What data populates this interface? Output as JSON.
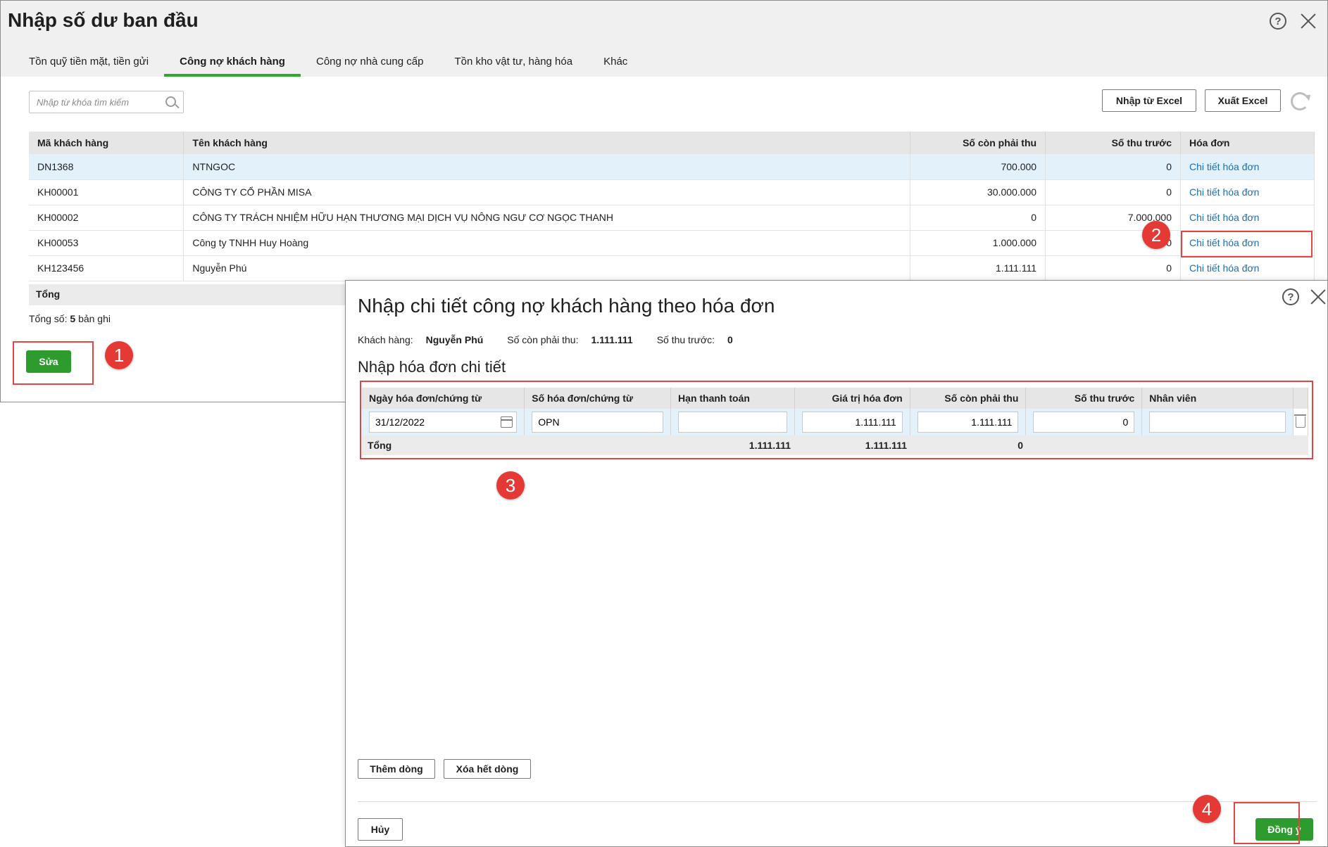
{
  "main": {
    "title": "Nhập số dư ban đầu",
    "tabs": [
      {
        "label": "Tồn quỹ tiền mặt, tiền gửi"
      },
      {
        "label": "Công nợ khách hàng"
      },
      {
        "label": "Công nợ nhà cung cấp"
      },
      {
        "label": "Tồn kho vật tư, hàng hóa"
      },
      {
        "label": "Khác"
      }
    ],
    "search_placeholder": "Nhập từ khóa tìm kiếm",
    "import_excel": "Nhập từ Excel",
    "export_excel": "Xuất Excel",
    "columns": [
      "Mã khách hàng",
      "Tên khách hàng",
      "Số còn phải thu",
      "Số thu trước",
      "Hóa đơn"
    ],
    "rows": [
      {
        "code": "DN1368",
        "name": "NTNGOC",
        "receivable": "700.000",
        "prepaid": "0",
        "invoice": "Chi tiết hóa đơn"
      },
      {
        "code": "KH00001",
        "name": "CÔNG TY CỔ PHẦN MISA",
        "receivable": "30.000.000",
        "prepaid": "0",
        "invoice": "Chi tiết hóa đơn"
      },
      {
        "code": "KH00002",
        "name": "CÔNG TY TRÁCH NHIỆM HỮU HẠN THƯƠNG MẠI DỊCH VỤ NÔNG NGƯ CƠ NGỌC THANH",
        "receivable": "0",
        "prepaid": "7.000.000",
        "invoice": "Chi tiết hóa đơn"
      },
      {
        "code": "KH00053",
        "name": "Công ty TNHH Huy Hoàng",
        "receivable": "1.000.000",
        "prepaid": "0",
        "invoice": "Chi tiết hóa đơn"
      },
      {
        "code": "KH123456",
        "name": "Nguyễn Phú",
        "receivable": "1.111.111",
        "prepaid": "0",
        "invoice": "Chi tiết hóa đơn"
      }
    ],
    "total_label": "Tổng",
    "record_count_prefix": "Tổng số:",
    "record_count_value": "5",
    "record_count_suffix": "bản ghi",
    "edit_button": "Sửa"
  },
  "annotations": [
    "1",
    "2",
    "3",
    "4"
  ],
  "dialog": {
    "title": "Nhập chi tiết công nợ khách hàng theo hóa đơn",
    "customer_label": "Khách hàng:",
    "customer_value": "Nguyễn Phú",
    "receivable_label": "Số còn phải thu:",
    "receivable_value": "1.111.111",
    "prepaid_label": "Số thu trước:",
    "prepaid_value": "0",
    "subtitle": "Nhập hóa đơn chi tiết",
    "columns": [
      "Ngày hóa đơn/chứng từ",
      "Số hóa đơn/chứng từ",
      "Hạn thanh toán",
      "Giá trị hóa đơn",
      "Số còn phải thu",
      "Số thu trước",
      "Nhân viên"
    ],
    "row": {
      "date": "31/12/2022",
      "invoice_no": "OPN",
      "due_date": "",
      "invoice_value": "1.111.111",
      "receivable": "1.111.111",
      "prepaid": "0",
      "employee": ""
    },
    "total_label": "Tổng",
    "total_invoice_value": "1.111.111",
    "total_receivable": "1.111.111",
    "total_prepaid": "0",
    "add_row": "Thêm dòng",
    "clear_rows": "Xóa hết dòng",
    "cancel": "Hủy",
    "ok": "Đồng ý"
  }
}
